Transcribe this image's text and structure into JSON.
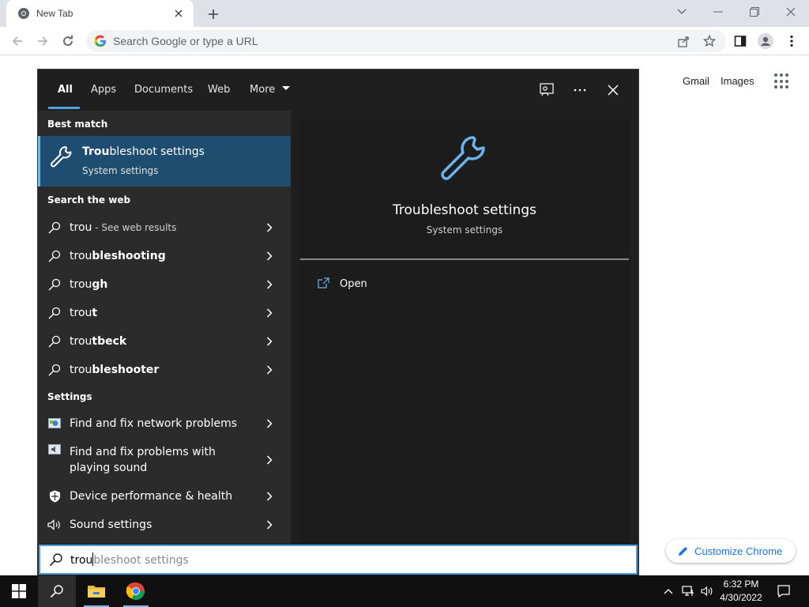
{
  "browser": {
    "tab": {
      "title": "New Tab",
      "favicon": "chrome-icon",
      "close_icon": "close-icon"
    },
    "new_tab_icon": "plus-icon",
    "window_controls": [
      "chevron-down-icon",
      "minimize-icon",
      "restore-icon",
      "close-icon"
    ],
    "toolbar": {
      "back_icon": "arrow-left-icon",
      "forward_icon": "arrow-right-icon",
      "reload_icon": "reload-icon",
      "omnibox_placeholder": "Search Google or type a URL",
      "right_icons": [
        "share-icon",
        "star-icon",
        "side-panel-icon",
        "profile-icon",
        "more-vertical-icon"
      ]
    }
  },
  "ntp": {
    "gmail": "Gmail",
    "images": "Images",
    "apps_icon": "apps-grid-icon",
    "customize_label": "Customize Chrome",
    "customize_icon": "pencil-icon"
  },
  "search_panel": {
    "tabs": [
      "All",
      "Apps",
      "Documents",
      "Web",
      "More"
    ],
    "active_tab": "All",
    "header_icons": [
      "feedback-icon",
      "more-horizontal-icon",
      "close-icon"
    ],
    "best_match": {
      "heading": "Best match",
      "title_bold": "Trou",
      "title_rest": "bleshoot settings",
      "subtitle": "System settings",
      "icon": "wrench-icon"
    },
    "web": {
      "heading": "Search the web",
      "items": [
        {
          "bold": "",
          "plain": "trou",
          "suffix": " - See web results"
        },
        {
          "bold": "bleshooting",
          "plain": "trou",
          "suffix": ""
        },
        {
          "bold": "gh",
          "plain": "trou",
          "suffix": ""
        },
        {
          "bold": "t",
          "plain": "trou",
          "suffix": ""
        },
        {
          "bold": "tbeck",
          "plain": "trou",
          "suffix": ""
        },
        {
          "bold": "bleshooter",
          "plain": "trou",
          "suffix": ""
        }
      ]
    },
    "settings": {
      "heading": "Settings",
      "items": [
        {
          "label": "Find and fix network problems",
          "icon": "network-troubleshoot-icon"
        },
        {
          "label": "Find and fix problems with playing sound",
          "icon": "sound-troubleshoot-icon"
        },
        {
          "label": "Device performance & health",
          "icon": "shield-icon"
        },
        {
          "label": "Sound settings",
          "icon": "speaker-icon"
        }
      ]
    },
    "preview": {
      "title": "Troubleshoot settings",
      "subtitle": "System settings",
      "action": "Open",
      "action_icon": "open-external-icon"
    },
    "input": {
      "typed": "trou",
      "ghost": "bleshoot settings"
    }
  },
  "taskbar": {
    "buttons": [
      "windows-start-icon",
      "search-icon",
      "file-explorer-icon",
      "chrome-icon"
    ],
    "tray_icons": [
      "chevron-up-icon",
      "network-icon",
      "volume-icon"
    ],
    "time": "6:32 PM",
    "date": "4/30/2022",
    "notification_icon": "notification-icon"
  },
  "colors": {
    "accent": "#4ca0e0",
    "best_match_bg": "#1e4d70",
    "panel_bg": "#1f1f1f",
    "list_bg": "#2b2b2b",
    "taskbar_bg": "#101010",
    "chrome_blue": "#1a73e8"
  }
}
